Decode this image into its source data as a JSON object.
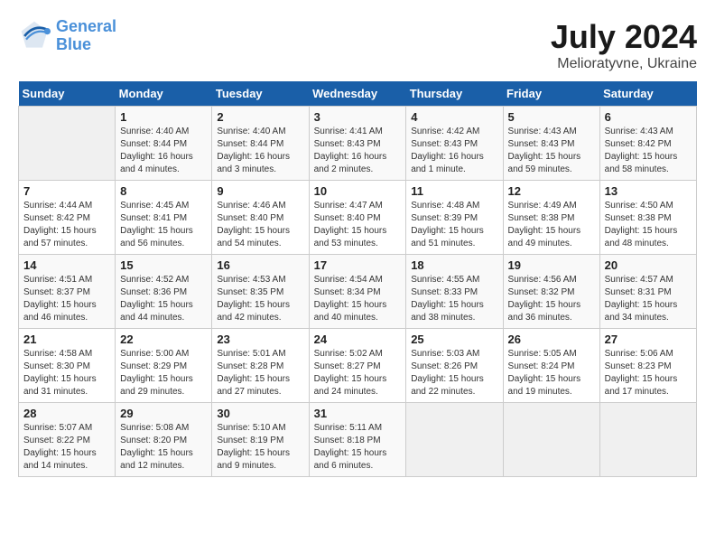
{
  "header": {
    "logo_line1": "General",
    "logo_line2": "Blue",
    "title": "July 2024",
    "subtitle": "Melioratyvne, Ukraine"
  },
  "columns": [
    "Sunday",
    "Monday",
    "Tuesday",
    "Wednesday",
    "Thursday",
    "Friday",
    "Saturday"
  ],
  "weeks": [
    [
      {
        "day": "",
        "sunrise": "",
        "sunset": "",
        "daylight": ""
      },
      {
        "day": "1",
        "sunrise": "Sunrise: 4:40 AM",
        "sunset": "Sunset: 8:44 PM",
        "daylight": "Daylight: 16 hours and 4 minutes."
      },
      {
        "day": "2",
        "sunrise": "Sunrise: 4:40 AM",
        "sunset": "Sunset: 8:44 PM",
        "daylight": "Daylight: 16 hours and 3 minutes."
      },
      {
        "day": "3",
        "sunrise": "Sunrise: 4:41 AM",
        "sunset": "Sunset: 8:43 PM",
        "daylight": "Daylight: 16 hours and 2 minutes."
      },
      {
        "day": "4",
        "sunrise": "Sunrise: 4:42 AM",
        "sunset": "Sunset: 8:43 PM",
        "daylight": "Daylight: 16 hours and 1 minute."
      },
      {
        "day": "5",
        "sunrise": "Sunrise: 4:43 AM",
        "sunset": "Sunset: 8:43 PM",
        "daylight": "Daylight: 15 hours and 59 minutes."
      },
      {
        "day": "6",
        "sunrise": "Sunrise: 4:43 AM",
        "sunset": "Sunset: 8:42 PM",
        "daylight": "Daylight: 15 hours and 58 minutes."
      }
    ],
    [
      {
        "day": "7",
        "sunrise": "Sunrise: 4:44 AM",
        "sunset": "Sunset: 8:42 PM",
        "daylight": "Daylight: 15 hours and 57 minutes."
      },
      {
        "day": "8",
        "sunrise": "Sunrise: 4:45 AM",
        "sunset": "Sunset: 8:41 PM",
        "daylight": "Daylight: 15 hours and 56 minutes."
      },
      {
        "day": "9",
        "sunrise": "Sunrise: 4:46 AM",
        "sunset": "Sunset: 8:40 PM",
        "daylight": "Daylight: 15 hours and 54 minutes."
      },
      {
        "day": "10",
        "sunrise": "Sunrise: 4:47 AM",
        "sunset": "Sunset: 8:40 PM",
        "daylight": "Daylight: 15 hours and 53 minutes."
      },
      {
        "day": "11",
        "sunrise": "Sunrise: 4:48 AM",
        "sunset": "Sunset: 8:39 PM",
        "daylight": "Daylight: 15 hours and 51 minutes."
      },
      {
        "day": "12",
        "sunrise": "Sunrise: 4:49 AM",
        "sunset": "Sunset: 8:38 PM",
        "daylight": "Daylight: 15 hours and 49 minutes."
      },
      {
        "day": "13",
        "sunrise": "Sunrise: 4:50 AM",
        "sunset": "Sunset: 8:38 PM",
        "daylight": "Daylight: 15 hours and 48 minutes."
      }
    ],
    [
      {
        "day": "14",
        "sunrise": "Sunrise: 4:51 AM",
        "sunset": "Sunset: 8:37 PM",
        "daylight": "Daylight: 15 hours and 46 minutes."
      },
      {
        "day": "15",
        "sunrise": "Sunrise: 4:52 AM",
        "sunset": "Sunset: 8:36 PM",
        "daylight": "Daylight: 15 hours and 44 minutes."
      },
      {
        "day": "16",
        "sunrise": "Sunrise: 4:53 AM",
        "sunset": "Sunset: 8:35 PM",
        "daylight": "Daylight: 15 hours and 42 minutes."
      },
      {
        "day": "17",
        "sunrise": "Sunrise: 4:54 AM",
        "sunset": "Sunset: 8:34 PM",
        "daylight": "Daylight: 15 hours and 40 minutes."
      },
      {
        "day": "18",
        "sunrise": "Sunrise: 4:55 AM",
        "sunset": "Sunset: 8:33 PM",
        "daylight": "Daylight: 15 hours and 38 minutes."
      },
      {
        "day": "19",
        "sunrise": "Sunrise: 4:56 AM",
        "sunset": "Sunset: 8:32 PM",
        "daylight": "Daylight: 15 hours and 36 minutes."
      },
      {
        "day": "20",
        "sunrise": "Sunrise: 4:57 AM",
        "sunset": "Sunset: 8:31 PM",
        "daylight": "Daylight: 15 hours and 34 minutes."
      }
    ],
    [
      {
        "day": "21",
        "sunrise": "Sunrise: 4:58 AM",
        "sunset": "Sunset: 8:30 PM",
        "daylight": "Daylight: 15 hours and 31 minutes."
      },
      {
        "day": "22",
        "sunrise": "Sunrise: 5:00 AM",
        "sunset": "Sunset: 8:29 PM",
        "daylight": "Daylight: 15 hours and 29 minutes."
      },
      {
        "day": "23",
        "sunrise": "Sunrise: 5:01 AM",
        "sunset": "Sunset: 8:28 PM",
        "daylight": "Daylight: 15 hours and 27 minutes."
      },
      {
        "day": "24",
        "sunrise": "Sunrise: 5:02 AM",
        "sunset": "Sunset: 8:27 PM",
        "daylight": "Daylight: 15 hours and 24 minutes."
      },
      {
        "day": "25",
        "sunrise": "Sunrise: 5:03 AM",
        "sunset": "Sunset: 8:26 PM",
        "daylight": "Daylight: 15 hours and 22 minutes."
      },
      {
        "day": "26",
        "sunrise": "Sunrise: 5:05 AM",
        "sunset": "Sunset: 8:24 PM",
        "daylight": "Daylight: 15 hours and 19 minutes."
      },
      {
        "day": "27",
        "sunrise": "Sunrise: 5:06 AM",
        "sunset": "Sunset: 8:23 PM",
        "daylight": "Daylight: 15 hours and 17 minutes."
      }
    ],
    [
      {
        "day": "28",
        "sunrise": "Sunrise: 5:07 AM",
        "sunset": "Sunset: 8:22 PM",
        "daylight": "Daylight: 15 hours and 14 minutes."
      },
      {
        "day": "29",
        "sunrise": "Sunrise: 5:08 AM",
        "sunset": "Sunset: 8:20 PM",
        "daylight": "Daylight: 15 hours and 12 minutes."
      },
      {
        "day": "30",
        "sunrise": "Sunrise: 5:10 AM",
        "sunset": "Sunset: 8:19 PM",
        "daylight": "Daylight: 15 hours and 9 minutes."
      },
      {
        "day": "31",
        "sunrise": "Sunrise: 5:11 AM",
        "sunset": "Sunset: 8:18 PM",
        "daylight": "Daylight: 15 hours and 6 minutes."
      },
      {
        "day": "",
        "sunrise": "",
        "sunset": "",
        "daylight": ""
      },
      {
        "day": "",
        "sunrise": "",
        "sunset": "",
        "daylight": ""
      },
      {
        "day": "",
        "sunrise": "",
        "sunset": "",
        "daylight": ""
      }
    ]
  ]
}
